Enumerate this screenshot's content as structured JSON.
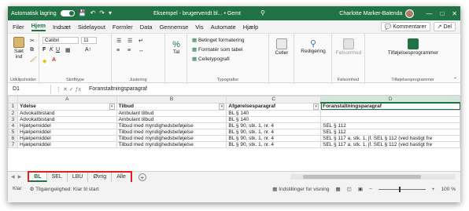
{
  "titlebar": {
    "autosave_label": "Automatisk lagring",
    "doc_title": "Eksempel - brugervendt bl... • Gemt",
    "user_name": "Charlotte Marker-Balenda"
  },
  "menu": {
    "items": [
      "Filer",
      "Hjem",
      "Indsæt",
      "Sidelayout",
      "Formler",
      "Data",
      "Gennemse",
      "Vis",
      "Automate",
      "Hjælp"
    ],
    "comments_label": "Kommentarer",
    "share_label": "Del"
  },
  "ribbon": {
    "paste_label": "Sæt ind",
    "clipboard_group": "Udklipsholder",
    "font_name": "Calibri",
    "font_size": "11",
    "font_group": "Skrifttype",
    "alignment_group": "Justering",
    "number_label": "Tal",
    "cond_format": "Betinget formatering",
    "format_table": "Formatér som tabel",
    "cell_styles": "Celletypografi",
    "styles_group": "Typografier",
    "cells_label": "Celler",
    "editing_label": "Redigering",
    "sensitivity_label": "Følsomhed",
    "sensitivity_group": "Følsomhed",
    "addins_label": "Tilføjelsesprogrammer",
    "addins_group": "Tilføjelsesprogrammer"
  },
  "formula_bar": {
    "name_box": "D1",
    "value": "Foranstaltningsparagraf"
  },
  "grid": {
    "columns": [
      "A",
      "B",
      "C",
      "D"
    ],
    "rows": [
      {
        "n": "1",
        "cells": [
          "Ydelse",
          "Tilbud",
          "Afgørelsesparagraf",
          "Foranstaltningsparagraf"
        ]
      },
      {
        "n": "2",
        "cells": [
          "Advokatbistand",
          "Ambulant tilbud",
          "BL § 140",
          ""
        ]
      },
      {
        "n": "3",
        "cells": [
          "Advokatbistand",
          "Ambulant tilbud",
          "BL § 140",
          ""
        ]
      },
      {
        "n": "4",
        "cells": [
          "Hjælpemiddel",
          "Tilbud med myndighedsbeføjelse",
          "BL § 90, stk. 1, nr. 4",
          "SEL § 112"
        ]
      },
      {
        "n": "5",
        "cells": [
          "Hjælpemiddel",
          "Tilbud med myndighedsbeføjelse",
          "BL § 90, stk. 1, nr. 4",
          "SEL § 112"
        ]
      },
      {
        "n": "6",
        "cells": [
          "Hjælpemiddel",
          "Tilbud med myndighedsbeføjelse",
          "BL § 90, stk. 1, nr. 4",
          "SEL § 117 a, stk. 1, jf. SEL § 112 (ved hastigt fre"
        ]
      },
      {
        "n": "7",
        "cells": [
          "Hjælpemiddel",
          "Tilbud med myndighedsbeføjelse",
          "BL § 90, stk. 1, nr. 4",
          "SEL § 117 a, stk. 1, jf. SEL § 112 (ved hastigt fre"
        ]
      }
    ]
  },
  "sheets": {
    "tabs": [
      "BL",
      "SEL",
      "LBU",
      "Øvrig",
      "Alle"
    ],
    "active": "BL"
  },
  "status": {
    "ready": "Klar",
    "accessibility": "Tilgængelighed: Klar til start",
    "display_settings": "Indstillinger for visning",
    "zoom": "100 %"
  },
  "colors": {
    "accent": "#217346",
    "highlight": "#e2231a"
  }
}
